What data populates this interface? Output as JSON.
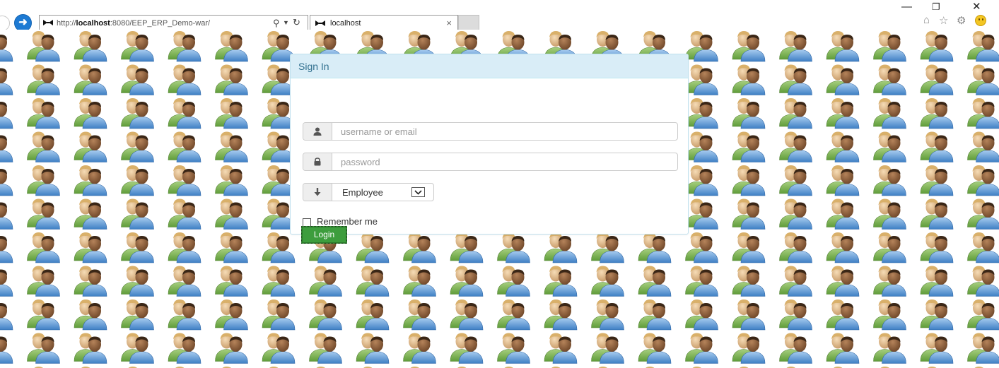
{
  "browser": {
    "url_prefix": "http://",
    "url_host": "localhost",
    "url_path": ":8080/EEP_ERP_Demo-war/",
    "tab_title": "localhost",
    "icons": {
      "back": "back-arrow-icon",
      "forward": "forward-arrow-icon",
      "search": "search-icon",
      "refresh": "refresh-icon",
      "close_tab": "close-icon",
      "home": "home-icon",
      "favorites": "star-icon",
      "settings": "gear-icon",
      "feedback": "smiley-icon"
    },
    "forward_color": "#1d7ad3"
  },
  "login": {
    "heading": "Sign In",
    "username_placeholder": "username or email",
    "password_placeholder": "password",
    "role_selected": "Employee",
    "remember_label": "Remember me",
    "login_label": "Login",
    "heading_color": "#31708f",
    "heading_bg": "#d9edf7",
    "button_color": "#3d9d3d"
  },
  "background": {
    "pattern_icon": "users-icon"
  }
}
